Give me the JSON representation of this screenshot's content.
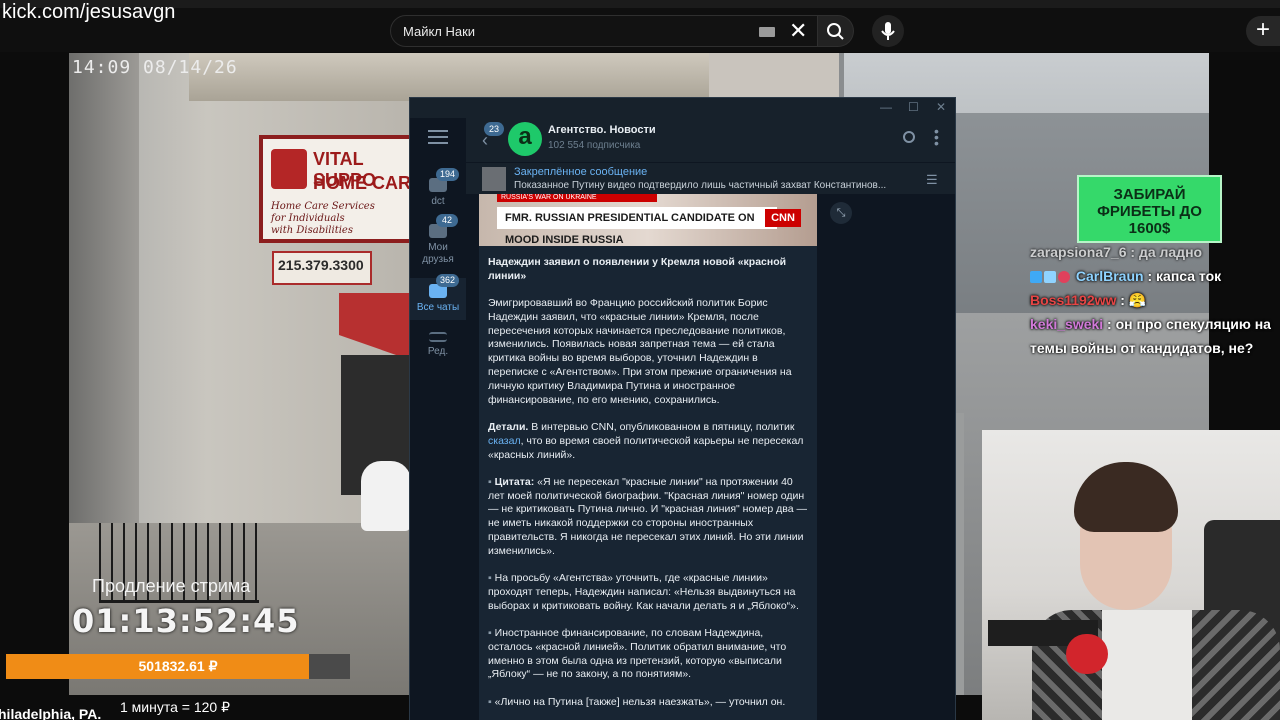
{
  "browser": {
    "watermark": "kick.com/jesusavgn",
    "search_value": "Майкл Наки",
    "clear_label": "✕",
    "new_tab_label": "+"
  },
  "stream": {
    "timestamp": "14:09  08/14/26",
    "extend_label": "Продление стрима",
    "extend_timer": "01:13:52:45",
    "donation_amount": "501832.61 ₽",
    "donation_progress": 0.88,
    "location": "hiladelphia, PA.",
    "rate": "1 минута = 120 ₽",
    "scene_sign_line1": "VITAL SUPPO",
    "scene_sign_line2": "HOME CAR",
    "scene_sign_script": "Home Care Services\nfor Individuals\nwith Disabilities",
    "scene_phone": "215.379.3300",
    "promo": "ЗАБИРАЙ ФРИБЕТЫ ДО 1600$"
  },
  "chat": [
    {
      "nick": "",
      "text": "zarapsiona7_6 : да ладно"
    },
    {
      "nick": "CarlBraun",
      "text": " : капса ток"
    },
    {
      "nick": "Boss1192ww",
      "text": " : 😤"
    },
    {
      "nick": "keki_sweki",
      "text": " : он про спекуляцию на темы войны от кандидатов, не?"
    }
  ],
  "telegram": {
    "window_controls": [
      "—",
      "☐",
      "✕"
    ],
    "folders": [
      {
        "label": "dct",
        "count": "194"
      },
      {
        "label": "Мои друзья",
        "count": "42"
      },
      {
        "label": "Все чаты",
        "count": "362"
      },
      {
        "label": "Ред.",
        "count": ""
      }
    ],
    "back_count": "23",
    "channel_name": "Агентство. Новости",
    "channel_subs": "102 554 подписчика",
    "avatar_letter": "a",
    "pinned_title": "Закреплённое сообщение",
    "pinned_text": "Показанное Путину видео подтвердило лишь частичный захват Константинов...",
    "media_band": "RUSSIA'S WAR ON UKRAINE",
    "media_caption": "FMR. RUSSIAN PRESIDENTIAL CANDIDATE ON MOOD INSIDE RUSSIA",
    "media_brand": "CNN",
    "message": {
      "title": "Надеждин заявил о появлении у Кремля новой «красной линии»",
      "p1": "Эмигрировавший во Францию российский политик Борис Надеждин заявил, что «красные линии» Кремля, после пересечения которых начинается преследование политиков, изменились. Появилась новая запретная тема — ей стала критика войны во время выборов, уточнил Надеждин в переписке с «Агентством». При этом прежние ограничения на личную критику Владимира Путина и иностранное финансирование, по его мнению, сохранились.",
      "p2_label": "Детали.",
      "p2_a": " В интервью CNN, опубликованном в пятницу, политик ",
      "p2_link": "сказал",
      "p2_b": ", что во время своей политической карьеры не пересекал «красных линий».",
      "p3_label": "Цитата:",
      "p3": " «Я не пересекал \"красные линии\" на протяжении 40 лет моей политической биографии. \"Красная линия\" номер один — не критиковать Путина лично. И \"красная линия\" номер два — не иметь никакой поддержки со стороны иностранных правительств. Я никогда не пересекал этих линий. Но эти линии изменились».",
      "p4": " На просьбу «Агентства» уточнить, где «красные линии» проходят теперь, Надеждин написал: «Нельзя выдвинуться на выборах и критиковать войну. Как начали делать я и „Яблоко“».",
      "p5": " Иностранное финансирование, по словам Надеждина, осталось «красной линией». Политик обратил внимание, что именно в этом была одна из претензий, которую «выписали „Яблоку“ — не по закону, а по понятиям».",
      "p6": " «Лично на Путина [также] нельзя наезжать», — уточнил он.",
      "bullet": "▪"
    }
  }
}
